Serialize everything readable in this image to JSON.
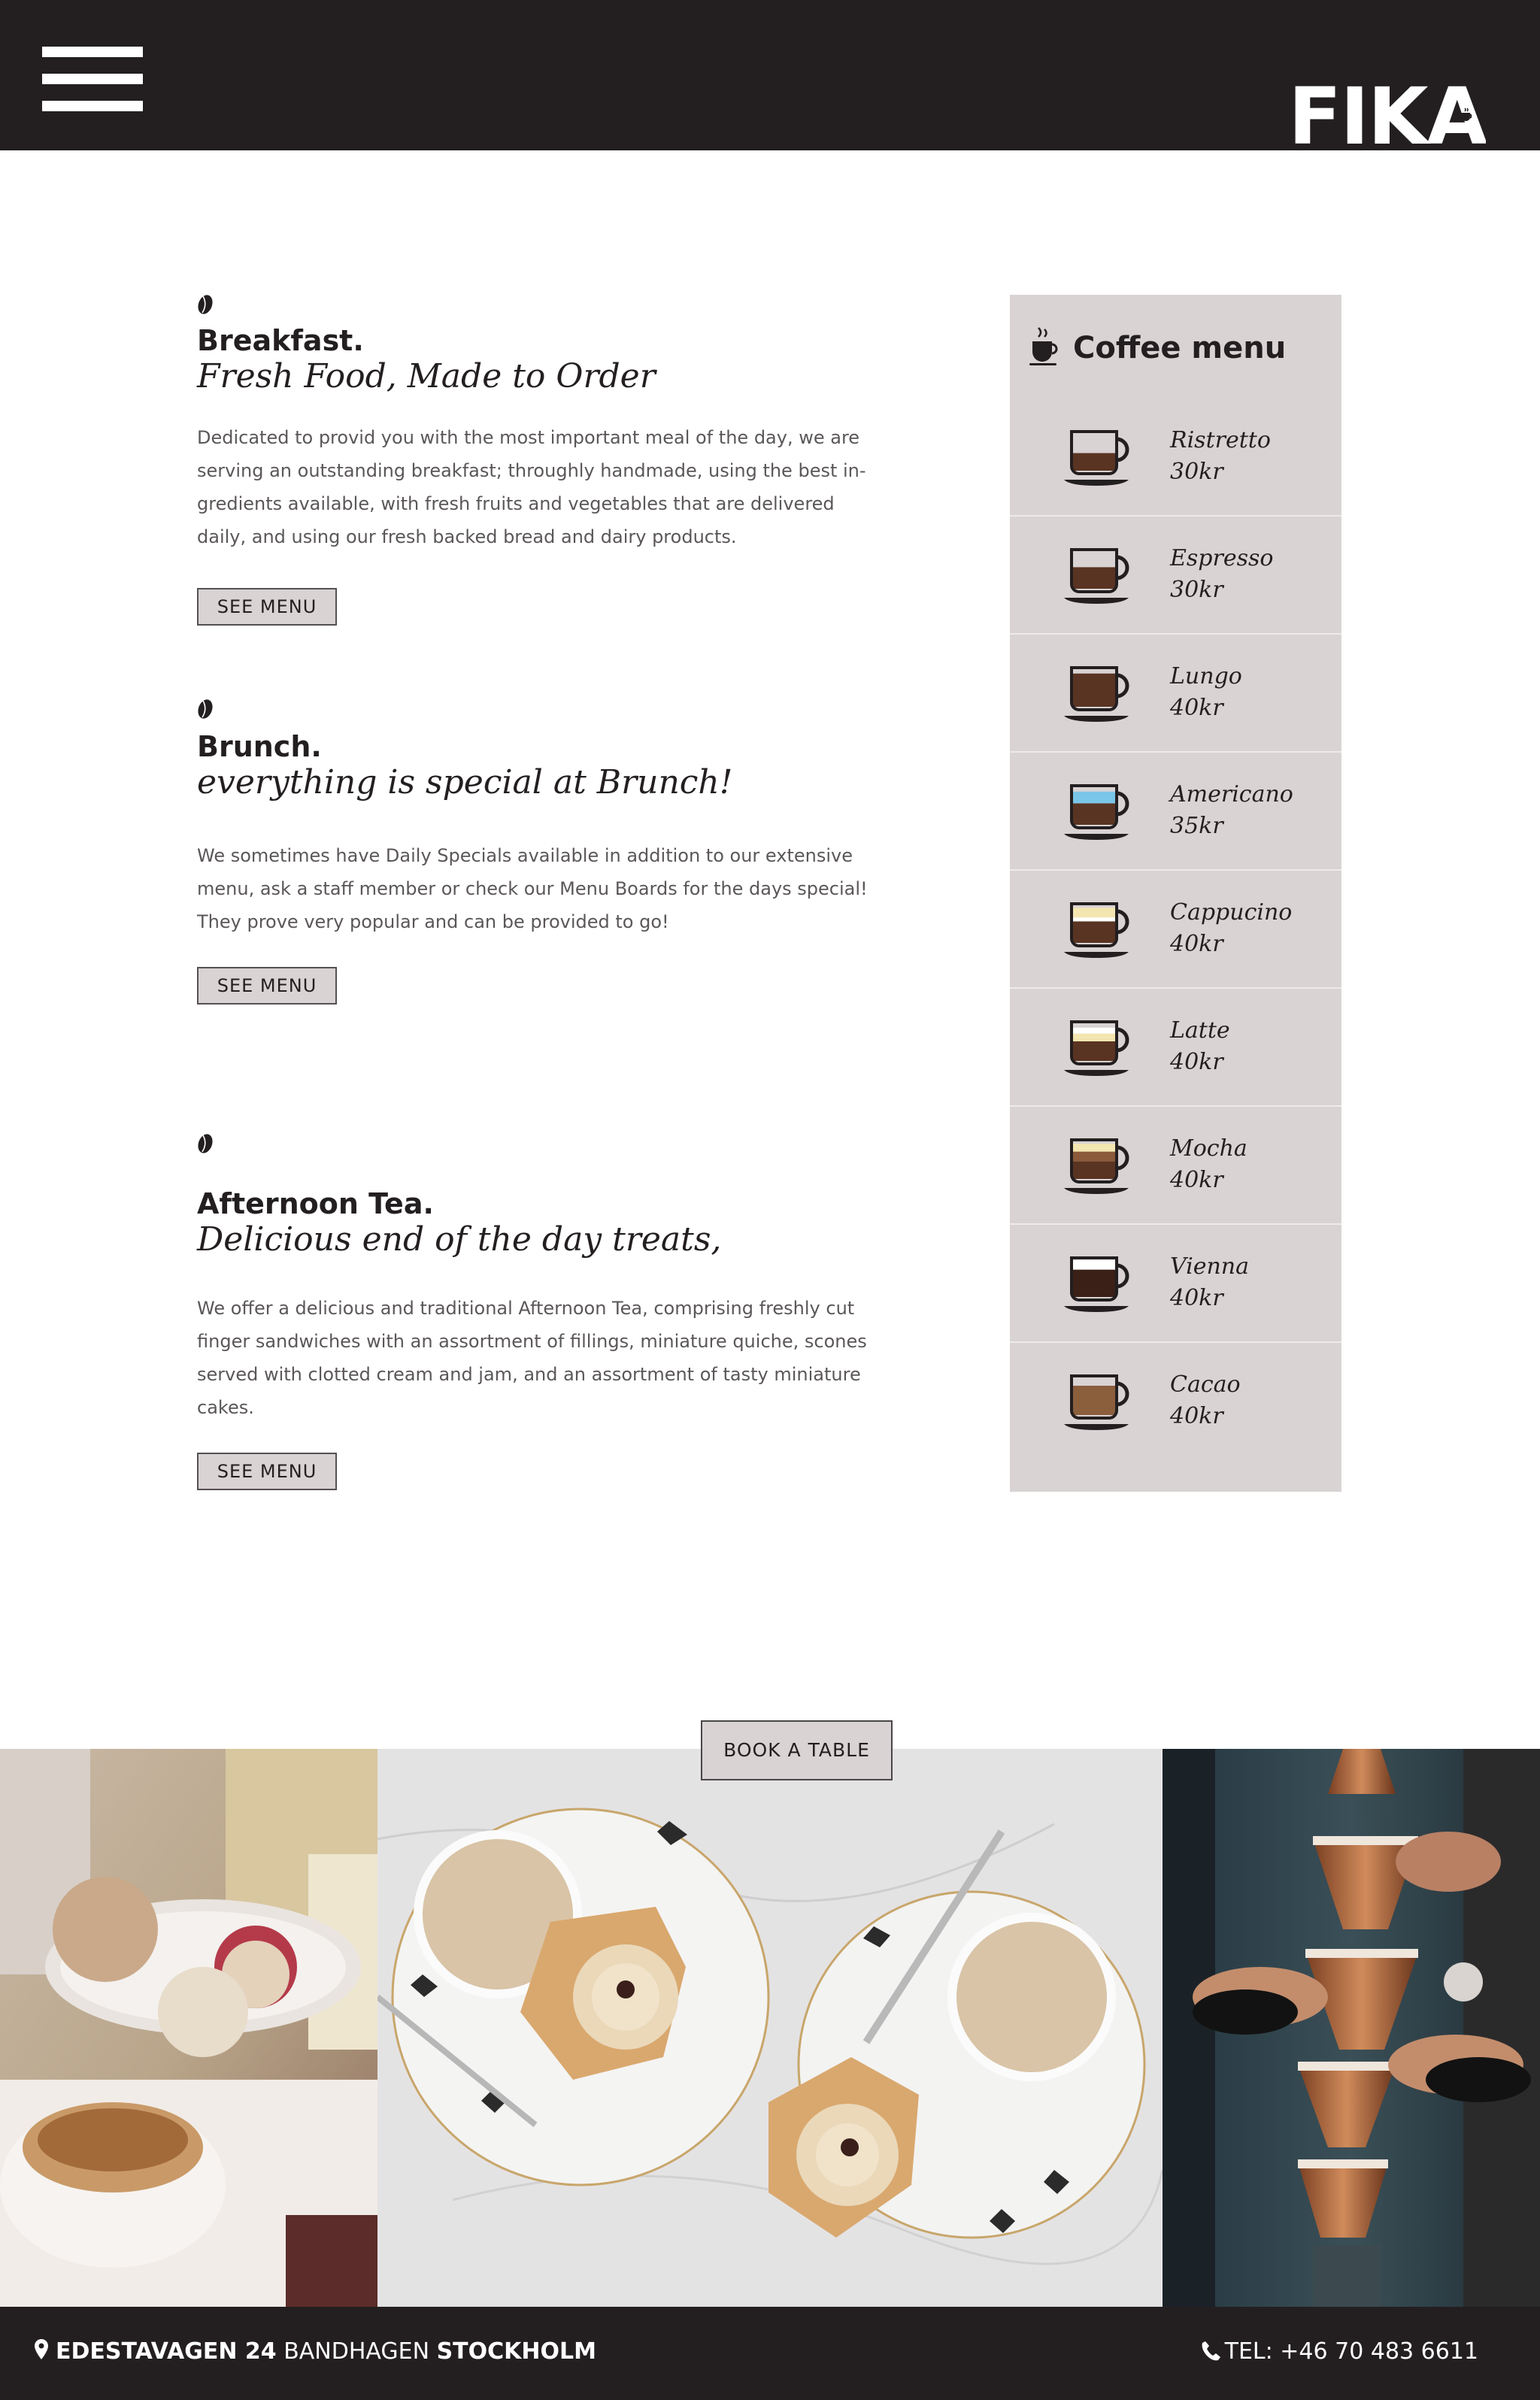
{
  "header": {
    "menu_icon": "hamburger-icon",
    "logo_text": "FIKA",
    "background": "#231f20"
  },
  "sections": [
    {
      "title": "Breakfast.",
      "subtitle": "Fresh Food, Made to Order",
      "text": "Dedicated to provid you with the most important meal of the day, we are serving an outstanding breakfast; throughly handmade, using the best in-gredients available, with fresh fruits and vegetables that are delivered daily, and using our fresh backed bread and dairy products.",
      "button_label": "SEE MENU"
    },
    {
      "title": "Brunch.",
      "subtitle": "everything is special at Brunch!",
      "text": "We sometimes have Daily Specials available in addition to our extensive menu, ask a staff member or check our Menu Boards for the days special! They prove very popular and can be provided to go!",
      "button_label": "SEE MENU"
    },
    {
      "title": "Afternoon Tea.",
      "subtitle": "Delicious end of the day treats,",
      "text": "We offer a delicious and traditional Afternoon Tea, comprising freshly cut finger sandwiches with an assortment of fillings, miniature quiche, scones served with clotted cream and jam, and an assortment of tasty miniature cakes.",
      "button_label": "SEE MENU"
    }
  ],
  "coffee_menu": {
    "title": "Coffee menu",
    "icon": "coffee-cup-icon",
    "background": "#d9d3d3",
    "items": [
      {
        "name": "Ristretto",
        "price": "30kr",
        "icon": "ristretto-cup-icon"
      },
      {
        "name": "Espresso",
        "price": "30kr",
        "icon": "espresso-cup-icon"
      },
      {
        "name": "Lungo",
        "price": "40kr",
        "icon": "lungo-cup-icon"
      },
      {
        "name": "Americano",
        "price": "35kr",
        "icon": "americano-cup-icon"
      },
      {
        "name": "Cappucino",
        "price": "40kr",
        "icon": "cappucino-cup-icon"
      },
      {
        "name": "Latte",
        "price": "40kr",
        "icon": "latte-cup-icon"
      },
      {
        "name": "Mocha",
        "price": "40kr",
        "icon": "mocha-cup-icon"
      },
      {
        "name": "Vienna",
        "price": "40kr",
        "icon": "vienna-cup-icon"
      },
      {
        "name": "Cacao",
        "price": "40kr",
        "icon": "cacao-cup-icon"
      }
    ]
  },
  "book_button": "BOOK A TABLE",
  "footer": {
    "street": "EDESTAVAGEN 24",
    "area": "BANDHAGEN",
    "city": "STOCKHOLM",
    "tel": "TEL: +46 70 483 6611"
  }
}
